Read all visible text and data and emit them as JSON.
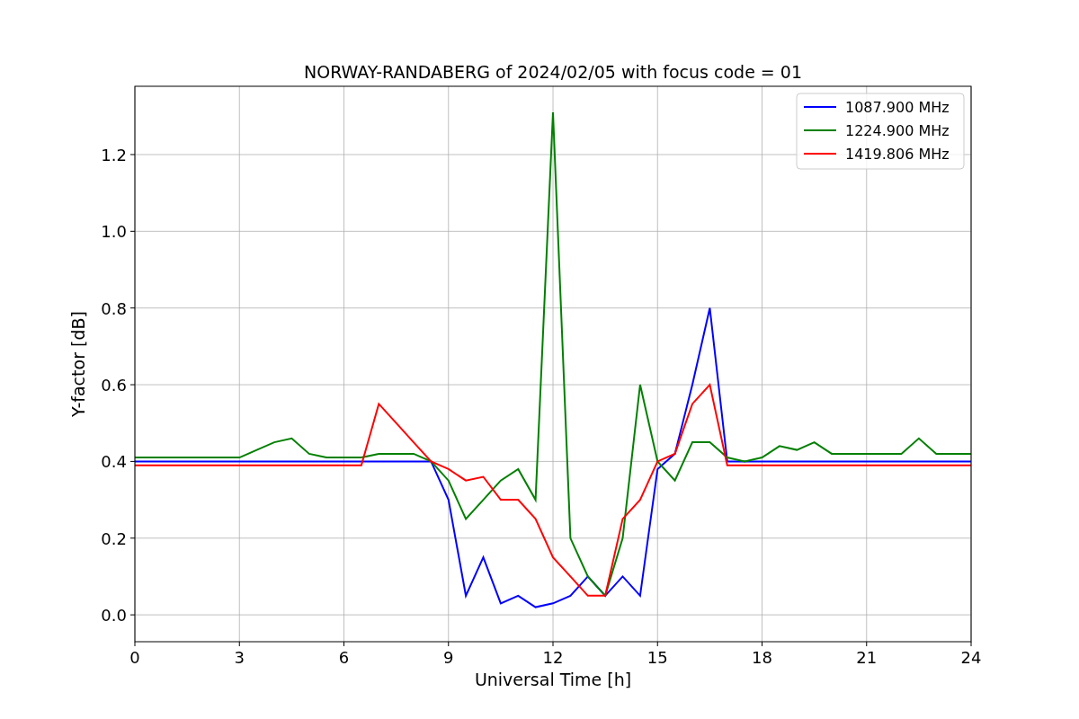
{
  "figure": {
    "chart_data": {
      "type": "line",
      "title": "NORWAY-RANDABERG of 2024/02/05 with focus code = 01",
      "xlabel": "Universal Time [h]",
      "ylabel": "Y-factor [dB]",
      "x": [
        0,
        0.5,
        1,
        1.5,
        2,
        2.5,
        3,
        3.5,
        4,
        4.5,
        5,
        5.5,
        6,
        6.5,
        7,
        7.5,
        8,
        8.5,
        9,
        9.5,
        10,
        10.5,
        11,
        11.5,
        12,
        12.5,
        13,
        13.5,
        14,
        14.5,
        15,
        15.5,
        16,
        16.5,
        17,
        17.5,
        18,
        18.5,
        19,
        19.5,
        20,
        20.5,
        21,
        21.5,
        22,
        22.5,
        23,
        23.5,
        24
      ],
      "series": [
        {
          "name": "1087.900 MHz",
          "color": "#0000ff",
          "values": [
            0.4,
            0.4,
            0.4,
            0.4,
            0.4,
            0.4,
            0.4,
            0.4,
            0.4,
            0.4,
            0.4,
            0.4,
            0.4,
            0.4,
            0.4,
            0.4,
            0.4,
            0.4,
            0.3,
            0.05,
            0.15,
            0.03,
            0.05,
            0.02,
            0.03,
            0.05,
            0.1,
            0.05,
            0.1,
            0.05,
            0.38,
            0.42,
            0.6,
            0.8,
            0.4,
            0.4,
            0.4,
            0.4,
            0.4,
            0.4,
            0.4,
            0.4,
            0.4,
            0.4,
            0.4,
            0.4,
            0.4,
            0.4,
            0.4
          ]
        },
        {
          "name": "1224.900 MHz",
          "color": "#008000",
          "values": [
            0.41,
            0.41,
            0.41,
            0.41,
            0.41,
            0.41,
            0.41,
            0.43,
            0.45,
            0.46,
            0.42,
            0.41,
            0.41,
            0.41,
            0.42,
            0.42,
            0.42,
            0.4,
            0.35,
            0.25,
            0.3,
            0.35,
            0.38,
            0.3,
            1.31,
            0.2,
            0.1,
            0.05,
            0.2,
            0.6,
            0.4,
            0.35,
            0.45,
            0.45,
            0.41,
            0.4,
            0.41,
            0.44,
            0.43,
            0.45,
            0.42,
            0.42,
            0.42,
            0.42,
            0.42,
            0.46,
            0.42,
            0.42,
            0.42
          ]
        },
        {
          "name": "1419.806 MHz",
          "color": "#ff0000",
          "values": [
            0.39,
            0.39,
            0.39,
            0.39,
            0.39,
            0.39,
            0.39,
            0.39,
            0.39,
            0.39,
            0.39,
            0.39,
            0.39,
            0.39,
            0.55,
            0.5,
            0.45,
            0.4,
            0.38,
            0.35,
            0.36,
            0.3,
            0.3,
            0.25,
            0.15,
            0.1,
            0.05,
            0.05,
            0.25,
            0.3,
            0.4,
            0.42,
            0.55,
            0.6,
            0.39,
            0.39,
            0.39,
            0.39,
            0.39,
            0.39,
            0.39,
            0.39,
            0.39,
            0.39,
            0.39,
            0.39,
            0.39,
            0.39,
            0.39
          ]
        }
      ],
      "grid": true,
      "legend": "upper right",
      "xlim": [
        0,
        24
      ],
      "ylim": [
        -0.07,
        1.378
      ],
      "xticks": [
        0,
        3,
        6,
        9,
        12,
        15,
        18,
        21,
        24
      ],
      "yticks": [
        {
          "value": 0,
          "label": "0.0"
        },
        {
          "value": 0.2,
          "label": "0.2"
        },
        {
          "value": 0.4,
          "label": "0.4"
        },
        {
          "value": 0.6,
          "label": "0.6"
        },
        {
          "value": 0.8,
          "label": "0.8"
        },
        {
          "value": 1.0,
          "label": "1.0"
        },
        {
          "value": 1.2,
          "label": "1.2"
        }
      ]
    }
  }
}
